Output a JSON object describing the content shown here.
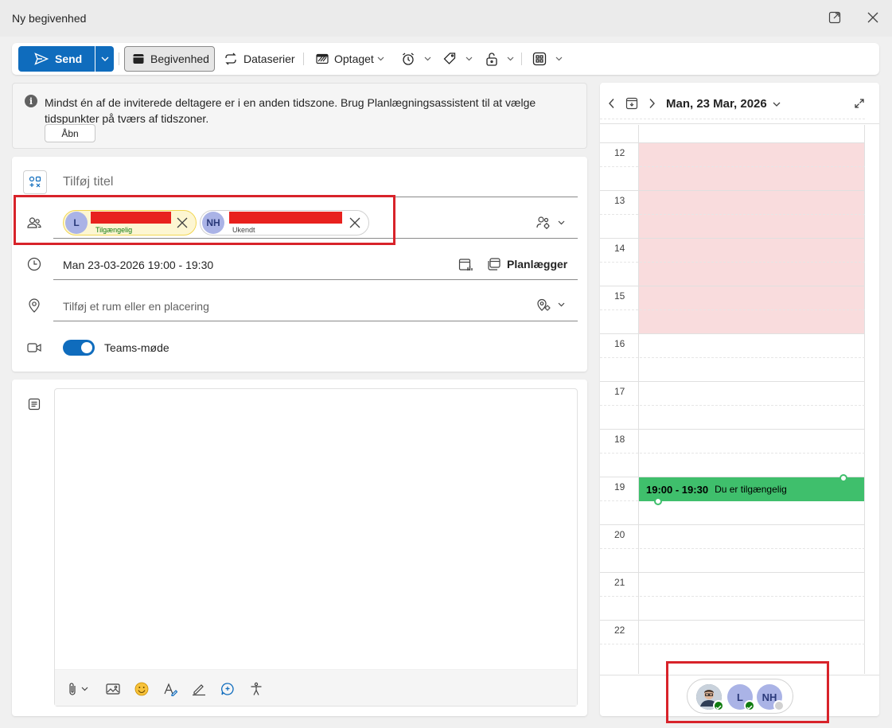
{
  "window": {
    "title": "Ny begivenhed",
    "popout_icon": "popout-icon",
    "close_icon": "close-icon"
  },
  "toolbar": {
    "send_label": "Send",
    "event_label": "Begivenhed",
    "series_label": "Dataserier",
    "busy_label": "Optaget",
    "icons": [
      "send-icon",
      "chevron-down-icon",
      "calendar-icon",
      "repeat-icon",
      "busy-icon",
      "reminder-icon",
      "tag-icon",
      "lock-icon",
      "apps-icon"
    ]
  },
  "info_bar": {
    "message": "Mindst én af de inviterede deltagere er i en anden tidszone. Brug Planlægningsassistent til at vælge tidspunkter på tværs af tidszoner.",
    "open_button": "Åbn"
  },
  "form": {
    "title_placeholder": "Tilføj titel",
    "attendees": [
      {
        "initials": "L",
        "status": "Tilgængelig",
        "status_color": "#107c10",
        "avatar_color": "#aab3e6",
        "chip_bg": "#fdf6d2",
        "chip_border": "#f2d653"
      },
      {
        "initials": "NH",
        "status": "Ukendt",
        "status_color": "#424242",
        "avatar_color": "#aab3e6",
        "chip_bg": "#ffffff",
        "chip_border": "#d1d1d1"
      }
    ],
    "datetime": "Man 23-03-2026 19:00 - 19:30",
    "scheduler_label": "Planlægger",
    "location_placeholder": "Tilføj et rum eller en placering",
    "teams_label": "Teams-møde",
    "teams_enabled": true
  },
  "calendar": {
    "date_label": "Man, 23 Mar, 2026",
    "hours": [
      "12",
      "13",
      "14",
      "15",
      "16",
      "17",
      "18",
      "19",
      "20",
      "21",
      "22"
    ],
    "busy_color": "#f9dcdd",
    "event": {
      "time": "19:00 - 19:30",
      "text": "Du er tilgængelig",
      "color": "#3fbf6c"
    },
    "footer_avatars": [
      {
        "initials": "",
        "kind": "photo",
        "status": "available"
      },
      {
        "initials": "L",
        "kind": "initials",
        "status": "available"
      },
      {
        "initials": "NH",
        "kind": "initials",
        "status": "unknown"
      }
    ]
  },
  "colors": {
    "accent": "#0f6cbd",
    "highlight": "#d8232a",
    "redaction": "#e8211e"
  }
}
